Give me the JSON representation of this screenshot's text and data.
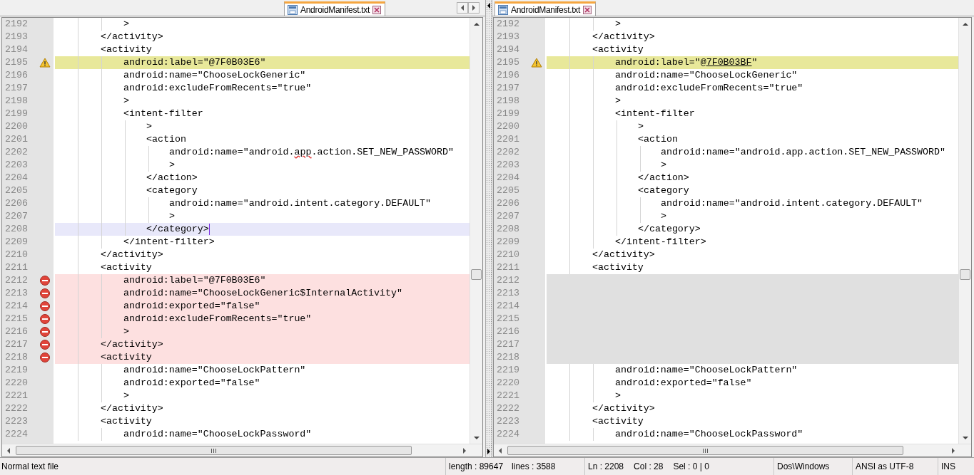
{
  "panes": [
    {
      "tabs": [
        {
          "label": "AndroidManifest.txt",
          "selected": true
        }
      ],
      "lines": [
        {
          "number": "2192",
          "kind": "normal",
          "text": "            >"
        },
        {
          "number": "2193",
          "kind": "normal",
          "text": "        </activity>"
        },
        {
          "number": "2194",
          "kind": "normal",
          "text": "        <activity"
        },
        {
          "number": "2195",
          "kind": "warning",
          "text": "            android:label=\"@7F0B03E6\""
        },
        {
          "number": "2196",
          "kind": "normal",
          "text": "            android:name=\"ChooseLockGeneric\""
        },
        {
          "number": "2197",
          "kind": "normal",
          "text": "            android:excludeFromRecents=\"true\""
        },
        {
          "number": "2198",
          "kind": "normal",
          "text": "            >"
        },
        {
          "number": "2199",
          "kind": "normal",
          "text": "            <intent-filter"
        },
        {
          "number": "2200",
          "kind": "normal",
          "text": "                >"
        },
        {
          "number": "2201",
          "kind": "normal",
          "text": "                <action"
        },
        {
          "number": "2202",
          "kind": "normal",
          "parts": [
            {
              "text": "                    android:name=\"android.",
              "kind": "plain"
            },
            {
              "text": "app",
              "kind": "misspelled"
            },
            {
              "text": ".action.SET_NEW_PASSWORD\"",
              "kind": "plain"
            }
          ]
        },
        {
          "number": "2203",
          "kind": "normal",
          "text": "                    >"
        },
        {
          "number": "2204",
          "kind": "normal",
          "text": "                </action>"
        },
        {
          "number": "2205",
          "kind": "normal",
          "text": "                <category"
        },
        {
          "number": "2206",
          "kind": "normal",
          "text": "                    android:name=\"android.intent.category.DEFAULT\""
        },
        {
          "number": "2207",
          "kind": "normal",
          "text": "                    >"
        },
        {
          "number": "2208",
          "kind": "current",
          "text": "                </category>"
        },
        {
          "number": "2209",
          "kind": "normal",
          "text": "            </intent-filter>"
        },
        {
          "number": "2210",
          "kind": "normal",
          "text": "        </activity>"
        },
        {
          "number": "2211",
          "kind": "normal",
          "text": "        <activity"
        },
        {
          "number": "2212",
          "kind": "deleted",
          "text": "            android:label=\"@7F0B03E6\""
        },
        {
          "number": "2213",
          "kind": "deleted",
          "text": "            android:name=\"ChooseLockGeneric$InternalActivity\""
        },
        {
          "number": "2214",
          "kind": "deleted",
          "text": "            android:exported=\"false\""
        },
        {
          "number": "2215",
          "kind": "deleted",
          "text": "            android:excludeFromRecents=\"true\""
        },
        {
          "number": "2216",
          "kind": "deleted",
          "text": "            >"
        },
        {
          "number": "2217",
          "kind": "deleted",
          "text": "        </activity>"
        },
        {
          "number": "2218",
          "kind": "deleted",
          "text": "        <activity"
        },
        {
          "number": "2219",
          "kind": "normal",
          "text": "            android:name=\"ChooseLockPattern\""
        },
        {
          "number": "2220",
          "kind": "normal",
          "text": "            android:exported=\"false\""
        },
        {
          "number": "2221",
          "kind": "normal",
          "text": "            >"
        },
        {
          "number": "2222",
          "kind": "normal",
          "text": "        </activity>"
        },
        {
          "number": "2223",
          "kind": "normal",
          "text": "        <activity"
        },
        {
          "number": "2224",
          "kind": "normal",
          "text": "            android:name=\"ChooseLockPassword\""
        }
      ]
    },
    {
      "tabs": [
        {
          "label": "AndroidManifest.txt",
          "selected": true
        }
      ],
      "lines": [
        {
          "number": "2192",
          "kind": "normal",
          "text": "            >"
        },
        {
          "number": "2193",
          "kind": "normal",
          "text": "        </activity>"
        },
        {
          "number": "2194",
          "kind": "normal",
          "text": "        <activity"
        },
        {
          "number": "2195",
          "kind": "warning",
          "parts": [
            {
              "text": "            android:label=\"@",
              "kind": "plain"
            },
            {
              "text": "7F0B03BF",
              "kind": "changed"
            },
            {
              "text": "\"",
              "kind": "plain"
            }
          ]
        },
        {
          "number": "2196",
          "kind": "normal",
          "text": "            android:name=\"ChooseLockGeneric\""
        },
        {
          "number": "2197",
          "kind": "normal",
          "text": "            android:excludeFromRecents=\"true\""
        },
        {
          "number": "2198",
          "kind": "normal",
          "text": "            >"
        },
        {
          "number": "2199",
          "kind": "normal",
          "text": "            <intent-filter"
        },
        {
          "number": "2200",
          "kind": "normal",
          "text": "                >"
        },
        {
          "number": "2201",
          "kind": "normal",
          "text": "                <action"
        },
        {
          "number": "2202",
          "kind": "normal",
          "text": "                    android:name=\"android.app.action.SET_NEW_PASSWORD\""
        },
        {
          "number": "2203",
          "kind": "normal",
          "text": "                    >"
        },
        {
          "number": "2204",
          "kind": "normal",
          "text": "                </action>"
        },
        {
          "number": "2205",
          "kind": "normal",
          "text": "                <category"
        },
        {
          "number": "2206",
          "kind": "normal",
          "text": "                    android:name=\"android.intent.category.DEFAULT\""
        },
        {
          "number": "2207",
          "kind": "normal",
          "text": "                    >"
        },
        {
          "number": "2208",
          "kind": "normal",
          "text": "                </category>"
        },
        {
          "number": "2209",
          "kind": "normal",
          "text": "            </intent-filter>"
        },
        {
          "number": "2210",
          "kind": "normal",
          "text": "        </activity>"
        },
        {
          "number": "2211",
          "kind": "normal",
          "text": "        <activity"
        },
        {
          "number": "2212",
          "kind": "blank"
        },
        {
          "number": "2213",
          "kind": "blank"
        },
        {
          "number": "2214",
          "kind": "blank"
        },
        {
          "number": "2215",
          "kind": "blank"
        },
        {
          "number": "2216",
          "kind": "blank"
        },
        {
          "number": "2217",
          "kind": "blank"
        },
        {
          "number": "2218",
          "kind": "blank"
        },
        {
          "number": "2219",
          "kind": "normal",
          "text": "            android:name=\"ChooseLockPattern\""
        },
        {
          "number": "2220",
          "kind": "normal",
          "text": "            android:exported=\"false\""
        },
        {
          "number": "2221",
          "kind": "normal",
          "text": "            >"
        },
        {
          "number": "2222",
          "kind": "normal",
          "text": "        </activity>"
        },
        {
          "number": "2223",
          "kind": "normal",
          "text": "        <activity"
        },
        {
          "number": "2224",
          "kind": "normal",
          "text": "            android:name=\"ChooseLockPassword\""
        }
      ]
    }
  ],
  "status_bar": [
    {
      "items": [
        "Normal text file"
      ]
    },
    {
      "items": [
        "length : 89647",
        "lines : 3588"
      ]
    },
    {
      "items": [
        "Ln : 2208",
        "Col : 28",
        "Sel : 0 | 0"
      ]
    },
    {
      "items": [
        "Dos\\Windows"
      ]
    },
    {
      "items": [
        "ANSI as UTF-8"
      ]
    },
    {
      "items": [
        "INS"
      ]
    }
  ]
}
